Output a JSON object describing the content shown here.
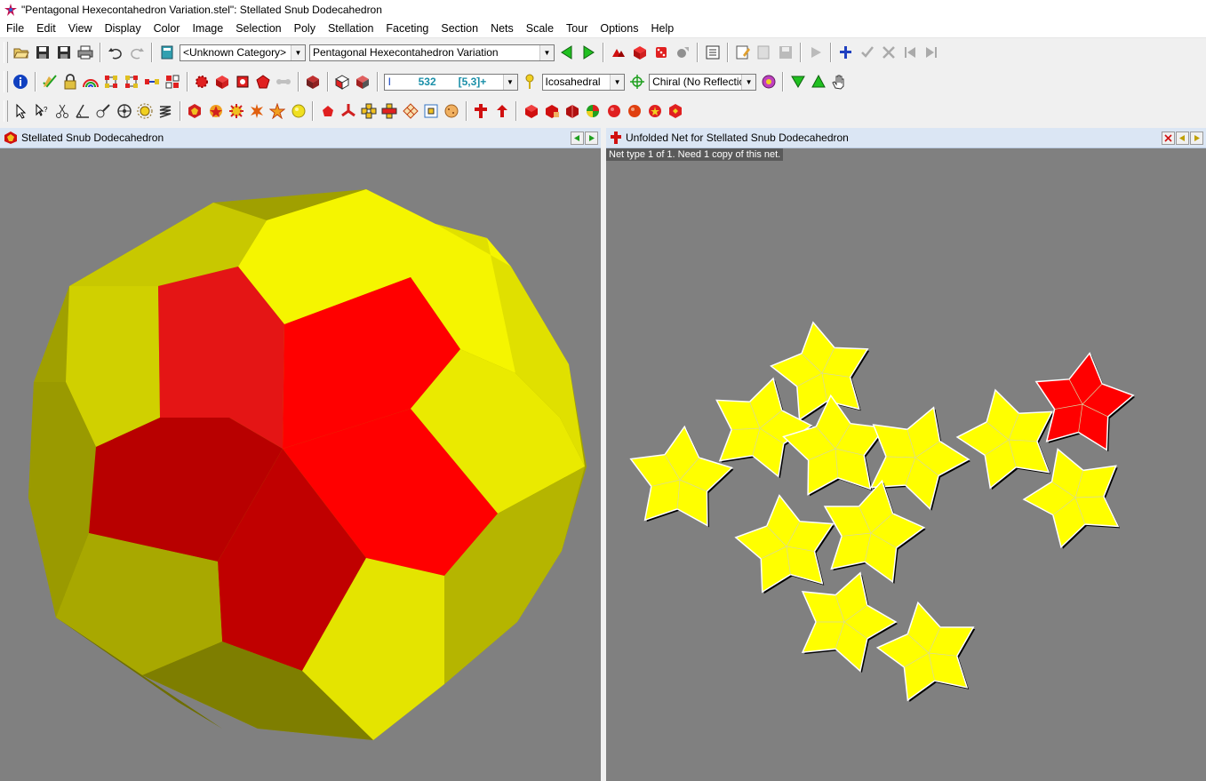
{
  "window": {
    "title": "\"Pentagonal Hexecontahedron Variation.stel\": Stellated Snub Dodecahedron"
  },
  "menu": [
    "File",
    "Edit",
    "View",
    "Display",
    "Color",
    "Image",
    "Selection",
    "Poly",
    "Stellation",
    "Faceting",
    "Section",
    "Nets",
    "Scale",
    "Tour",
    "Options",
    "Help"
  ],
  "toolbar1": {
    "category": "<Unknown Category>",
    "model": "Pentagonal Hexecontahedron Variation"
  },
  "toolbar2": {
    "id_prefix": "I",
    "index": "532",
    "symmetry_code": "[5,3]+",
    "symmetry": "Icosahedral",
    "reflection": "Chiral (No Reflection)"
  },
  "left_pane": {
    "title": "Stellated Snub Dodecahedron"
  },
  "right_pane": {
    "title": "Unfolded Net for Stellated Snub Dodecahedron",
    "info": "Net type 1 of 1.  Need 1 copy of this net."
  },
  "colors": {
    "yellow": "#ffff00",
    "red": "#ff0000",
    "viewport_bg": "#808080",
    "header_bg": "#dbe6f4"
  }
}
